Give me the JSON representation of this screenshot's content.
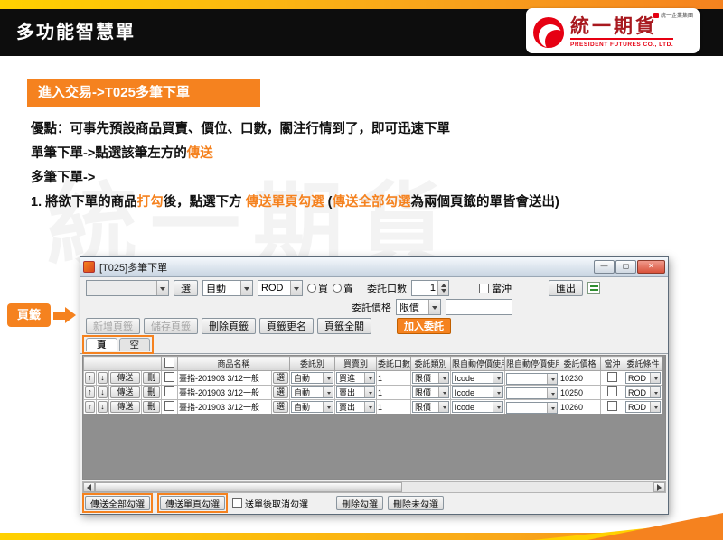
{
  "colors": {
    "accent": "#f5821f",
    "yellow": "#ffd100",
    "logo_red": "#e60012",
    "brand_text": "#a8191f"
  },
  "header": {
    "title": "多功能智慧單"
  },
  "logo": {
    "group": "統一企業集團",
    "brand": "統一期貨",
    "subtitle": "PRESIDENT FUTURES CO., LTD."
  },
  "banner": "進入交易->T025多筆下單",
  "watermark": "統一期貨",
  "notes": {
    "line1": "優點：可事先預設商品買賣、價位、口數，關注行情到了，即可迅速下單",
    "line2_pre": "單筆下單->點選該筆左方的",
    "line2_hl": "傳送",
    "line3": "多筆下單->",
    "line4_pre": "1. 將欲下單的商品",
    "line4_hl1": "打勾",
    "line4_mid1": "後，點選下方 ",
    "line4_hl2": "傳送單頁勾選",
    "line4_mid2": " (",
    "line4_hl3": "傳送全部勾選",
    "line4_post": "為兩個頁籤的單皆會送出)"
  },
  "callout": {
    "label": "頁籤"
  },
  "win": {
    "title": "[T025]多筆下單",
    "controls": {
      "minimize": "—",
      "maximize": "▢",
      "close": "✕"
    },
    "toolbar": {
      "pick": "選",
      "otype": "自動",
      "cond": "ROD",
      "buy": "買",
      "sell": "賣",
      "qty_label": "委託口數",
      "qty_value": "1",
      "daytrade": "當沖",
      "export": "匯出",
      "price_label": "委託價格",
      "price_type": "限價",
      "price_value": ""
    },
    "tabbtns": {
      "add": "新增頁籤",
      "save": "儲存頁籤",
      "del": "刪除頁籤",
      "rename": "頁籤更名",
      "closeall": "頁籤全關",
      "add_order": "加入委託"
    },
    "tabs": [
      "頁",
      "空"
    ],
    "table": {
      "headers": [
        "商品名稱",
        "委託別",
        "買賣別",
        "委託口數",
        "委託類別",
        "限自動停價使用",
        "限自動停價使用",
        "委託價格",
        "當沖",
        "委託條件"
      ],
      "rowctl": {
        "up": "↑",
        "down": "↓",
        "send": "傳送",
        "del": "刪"
      },
      "rows": [
        {
          "product": "臺指-201903 3/12一般",
          "sel": "選",
          "otype": "自動",
          "side": "買進",
          "qty": "1",
          "ptype": "限價",
          "stop1": "Icode",
          "stop2": "",
          "price": "10230",
          "cond": "ROD"
        },
        {
          "product": "臺指-201903 3/12一般",
          "sel": "選",
          "otype": "自動",
          "side": "賣出",
          "qty": "1",
          "ptype": "限價",
          "stop1": "Icode",
          "stop2": "",
          "price": "10250",
          "cond": "ROD"
        },
        {
          "product": "臺指-201903 3/12一般",
          "sel": "選",
          "otype": "自動",
          "side": "賣出",
          "qty": "1",
          "ptype": "限價",
          "stop1": "Icode",
          "stop2": "",
          "price": "10260",
          "cond": "ROD"
        }
      ]
    },
    "bottom": {
      "send_all": "傳送全部勾選",
      "send_page": "傳送單頁勾選",
      "after_send": "送單後取消勾選",
      "del_checked": "刪除勾選",
      "del_unchecked": "刪除未勾選"
    }
  }
}
